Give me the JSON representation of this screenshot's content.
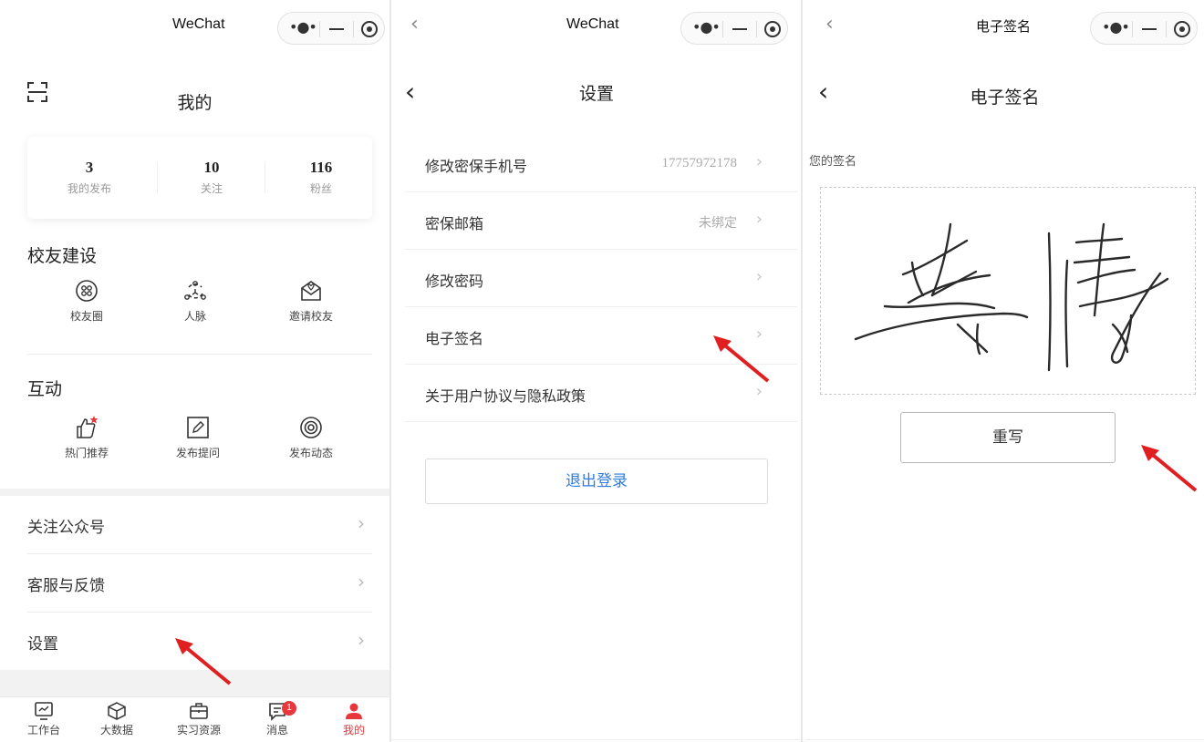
{
  "panel1": {
    "topbar_title": "WeChat",
    "page_title": "我的",
    "stats": [
      {
        "value": "3",
        "label": "我的发布"
      },
      {
        "value": "10",
        "label": "关注"
      },
      {
        "value": "116",
        "label": "粉丝"
      }
    ],
    "alumni_section": {
      "title": "校友建设",
      "items": [
        {
          "label": "校友圈",
          "icon": "alumni-circle-icon"
        },
        {
          "label": "人脉",
          "icon": "network-icon"
        },
        {
          "label": "邀请校友",
          "icon": "invite-mail-icon"
        }
      ]
    },
    "interact_section": {
      "title": "互动",
      "items": [
        {
          "label": "热门推荐",
          "icon": "thumbs-up-icon"
        },
        {
          "label": "发布提问",
          "icon": "edit-question-icon"
        },
        {
          "label": "发布动态",
          "icon": "post-camera-icon"
        }
      ]
    },
    "menu": [
      {
        "label": "关注公众号"
      },
      {
        "label": "客服与反馈"
      },
      {
        "label": "设置"
      }
    ],
    "tabbar": [
      {
        "label": "工作台",
        "icon": "workbench-icon"
      },
      {
        "label": "大数据",
        "icon": "cube-icon"
      },
      {
        "label": "实习资源",
        "icon": "briefcase-icon"
      },
      {
        "label": "消息",
        "icon": "message-icon",
        "badge": "1"
      },
      {
        "label": "我的",
        "icon": "person-icon",
        "active": true
      }
    ],
    "accent_color": "#e8383d"
  },
  "panel2": {
    "topbar_title": "WeChat",
    "page_title": "设置",
    "rows": [
      {
        "label": "修改密保手机号",
        "value": "17757972178"
      },
      {
        "label": "密保邮箱",
        "value": "未绑定"
      },
      {
        "label": "修改密码",
        "value": ""
      },
      {
        "label": "电子签名",
        "value": ""
      },
      {
        "label": "关于用户协议与隐私政策",
        "value": ""
      }
    ],
    "logout_label": "退出登录",
    "logout_color": "#2f7dde"
  },
  "panel3": {
    "topbar_title": "电子签名",
    "page_title": "电子签名",
    "signature_label": "您的签名",
    "rewrite_label": "重写"
  },
  "annotation_color": "#e02020"
}
